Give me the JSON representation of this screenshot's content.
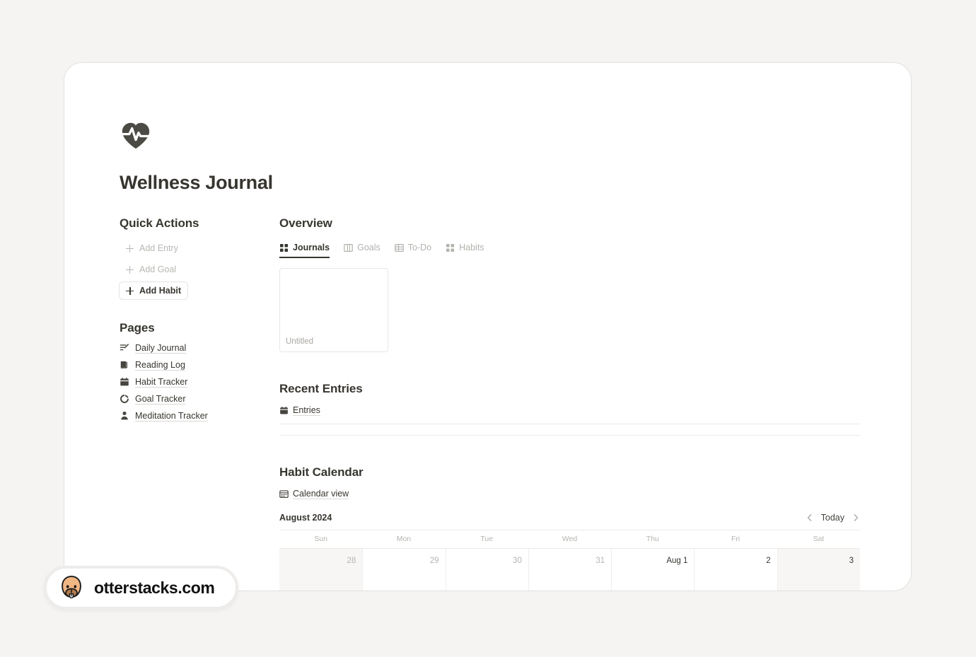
{
  "app": {
    "logo_icon": "heart-pulse-icon",
    "title": "Wellness Journal"
  },
  "quick_actions": {
    "heading": "Quick Actions",
    "items": [
      {
        "label": "Add Entry",
        "icon": "plus-icon",
        "active": false
      },
      {
        "label": "Add Goal",
        "icon": "plus-icon",
        "active": false
      },
      {
        "label": "Add Habit",
        "icon": "plus-icon",
        "active": true
      }
    ]
  },
  "pages": {
    "heading": "Pages",
    "items": [
      {
        "label": "Daily Journal",
        "icon": "edit-lines-icon"
      },
      {
        "label": "Reading Log",
        "icon": "book-icon"
      },
      {
        "label": "Habit Tracker",
        "icon": "calendar-icon"
      },
      {
        "label": "Goal Tracker",
        "icon": "progress-circle-icon"
      },
      {
        "label": "Meditation Tracker",
        "icon": "person-bust-icon"
      }
    ]
  },
  "overview": {
    "heading": "Overview",
    "tabs": [
      {
        "label": "Journals",
        "icon": "gallery-grid-icon",
        "active": true
      },
      {
        "label": "Goals",
        "icon": "board-columns-icon",
        "active": false
      },
      {
        "label": "To-Do",
        "icon": "table-icon",
        "active": false
      },
      {
        "label": "Habits",
        "icon": "gallery-grid-icon",
        "active": false
      }
    ],
    "cards": [
      {
        "title": "Untitled"
      }
    ]
  },
  "recent_entries": {
    "heading": "Recent Entries",
    "database_label": "Entries",
    "database_icon": "calendar-icon",
    "row_count": 2
  },
  "habit_calendar": {
    "heading": "Habit Calendar",
    "view_label": "Calendar view",
    "view_icon": "calendar-view-icon",
    "month_label": "August 2024",
    "prev_icon": "chevron-left-icon",
    "today_label": "Today",
    "next_icon": "chevron-right-icon",
    "weekdays": [
      "Sun",
      "Mon",
      "Tue",
      "Wed",
      "Thu",
      "Fri",
      "Sat"
    ],
    "weeks": [
      [
        {
          "num": "28",
          "muted": true,
          "weekend": true
        },
        {
          "num": "29",
          "muted": true,
          "weekend": false
        },
        {
          "num": "30",
          "muted": true,
          "weekend": false
        },
        {
          "num": "31",
          "muted": true,
          "weekend": false
        },
        {
          "num": "Aug 1",
          "muted": false,
          "weekend": false
        },
        {
          "num": "2",
          "muted": false,
          "weekend": false
        },
        {
          "num": "3",
          "muted": false,
          "weekend": true
        }
      ]
    ]
  },
  "watermark": {
    "label": "otterstacks.com",
    "icon": "otter-face-icon"
  },
  "colors": {
    "page_bg": "#f5f4f2",
    "card_bg": "#ffffff",
    "text": "#37352f",
    "muted": "#b6b4af",
    "border": "#e9e7e4",
    "weekend_bg": "#f7f6f4"
  }
}
